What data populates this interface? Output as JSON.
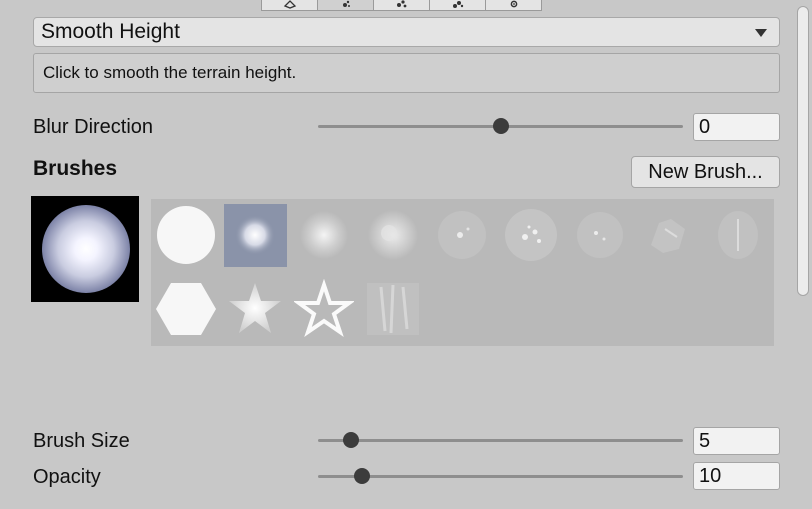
{
  "toolbar": {
    "tools": [
      {
        "icon": "raise-lower-terrain-icon",
        "active": false
      },
      {
        "icon": "paint-texture-icon",
        "active": true
      },
      {
        "icon": "paint-trees-icon",
        "active": false
      },
      {
        "icon": "paint-details-icon",
        "active": false
      },
      {
        "icon": "terrain-settings-icon",
        "active": false
      }
    ]
  },
  "tool_dropdown": {
    "value": "Smooth Height"
  },
  "help": {
    "text": "Click to smooth the terrain height."
  },
  "blur_direction": {
    "label": "Blur Direction",
    "value": "0",
    "fraction": 0.5
  },
  "brushes": {
    "heading": "Brushes",
    "new_brush_label": "New Brush...",
    "selected_index": 1,
    "items": [
      "circle-solid-brush-icon",
      "circle-soft-brush-icon",
      "circle-blurred-brush-icon",
      "cloud-brush-icon",
      "spots-brush-icon",
      "splatter-brush-icon",
      "speckle-brush-icon",
      "leaf-brush-icon",
      "grass-brush-icon",
      "hexagon-brush-icon",
      "star-soft-brush-icon",
      "star-outline-brush-icon",
      "bark-texture-brush-icon"
    ]
  },
  "brush_size": {
    "label": "Brush Size",
    "value": "5",
    "fraction": 0.09
  },
  "opacity": {
    "label": "Opacity",
    "value": "10",
    "fraction": 0.12
  }
}
